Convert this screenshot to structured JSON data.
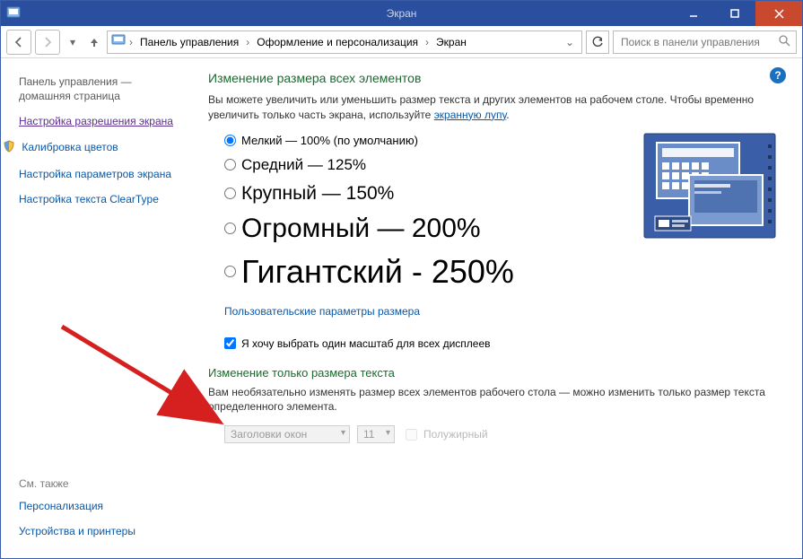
{
  "window": {
    "title": "Экран"
  },
  "breadcrumb": {
    "root": "Панель управления",
    "mid": "Оформление и персонализация",
    "leaf": "Экран"
  },
  "search": {
    "placeholder": "Поиск в панели управления"
  },
  "sidebar": {
    "home1": "Панель управления —",
    "home2": "домашняя страница",
    "items": [
      {
        "label": "Настройка разрешения экрана",
        "active": true,
        "icon": null
      },
      {
        "label": "Калибровка цветов",
        "active": false,
        "icon": "shield"
      },
      {
        "label": "Настройка параметров экрана",
        "active": false,
        "icon": null
      },
      {
        "label": "Настройка текста ClearType",
        "active": false,
        "icon": null
      }
    ],
    "see_also_hdr": "См. также",
    "see_also": [
      {
        "label": "Персонализация"
      },
      {
        "label": "Устройства и принтеры"
      }
    ]
  },
  "main": {
    "heading": "Изменение размера всех элементов",
    "desc_pre": "Вы можете увеличить или уменьшить размер текста и других элементов на рабочем столе. Чтобы временно увеличить только часть экрана, используйте ",
    "desc_link": "экранную лупу",
    "desc_post": ".",
    "size_options": [
      {
        "label": "Мелкий — 100% (по умолчанию)",
        "checked": true
      },
      {
        "label": "Средний — 125%",
        "checked": false
      },
      {
        "label": "Крупный — 150%",
        "checked": false
      },
      {
        "label": "Огромный — 200%",
        "checked": false
      },
      {
        "label": "Гигантский - 250%",
        "checked": false
      }
    ],
    "custom_link": "Пользовательские параметры размера",
    "same_scale_checkbox": "Я хочу выбрать один масштаб для всех дисплеев",
    "text_only_heading": "Изменение только размера текста",
    "text_only_desc": "Вам необязательно изменять размер всех элементов рабочего стола — можно изменить только размер текста определенного элемента.",
    "text_elem_select": "Заголовки окон",
    "text_size_select": "11",
    "bold_label": "Полужирный"
  }
}
